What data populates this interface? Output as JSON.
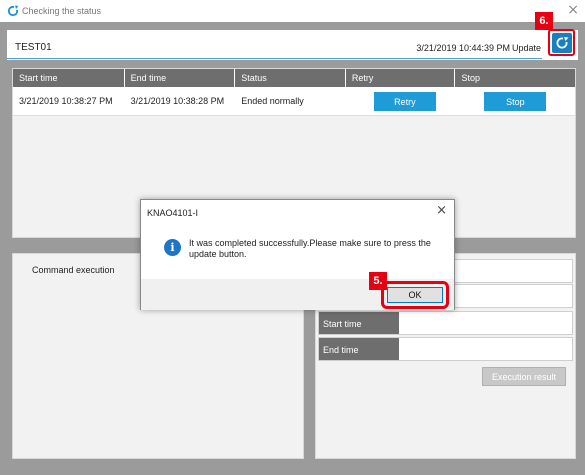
{
  "window": {
    "title": "Checking the status"
  },
  "header": {
    "name": "TEST01",
    "timestamp": "3/21/2019 10:44:39 PM",
    "update_label": "Update"
  },
  "annotations": {
    "step6": "6.",
    "step5": "5."
  },
  "table": {
    "columns": [
      "Start time",
      "End time",
      "Status",
      "Retry",
      "Stop"
    ],
    "rows": [
      {
        "start": "3/21/2019 10:38:27 PM",
        "end": "3/21/2019 10:38:28 PM",
        "status": "Ended normally",
        "retry": "Retry",
        "stop": "Stop"
      }
    ]
  },
  "command_panel": {
    "label": "Command execution"
  },
  "details": {
    "start_time": "Start time",
    "end_time": "End time",
    "exec_result": "Execution result"
  },
  "dialog": {
    "title": "KNAO4101-I",
    "message": "It was completed successfully.Please make sure to press the update button.",
    "ok": "OK"
  },
  "colors": {
    "accent": "#1f9bd7",
    "highlight": "#e60012",
    "header_bg": "#6e6e6e"
  },
  "icons": {
    "app": "refresh-icon",
    "update": "refresh-icon",
    "info": "info-icon",
    "close": "close-icon"
  }
}
